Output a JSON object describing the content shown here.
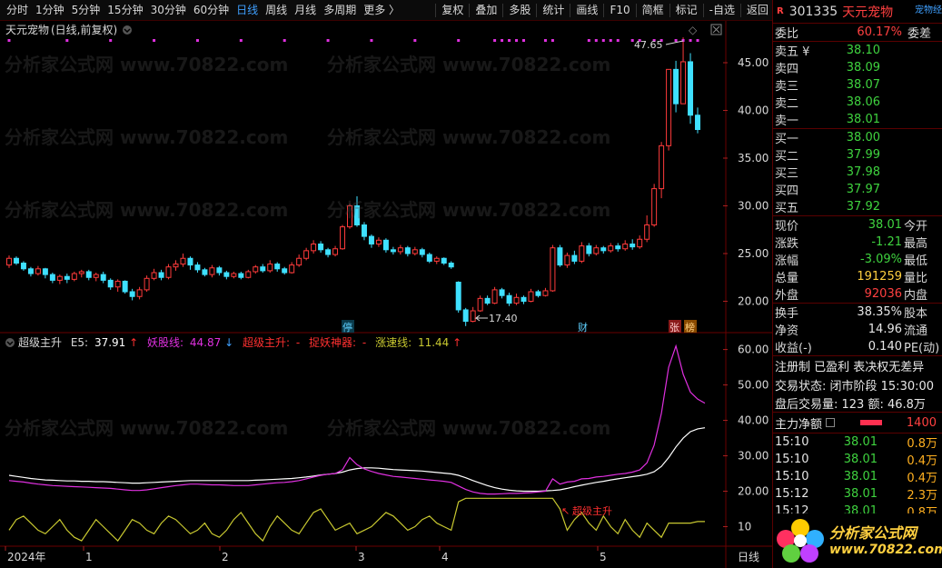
{
  "toolbar": {
    "left": [
      "分时",
      "1分钟",
      "5分钟",
      "15分钟",
      "30分钟",
      "60分钟",
      "日线",
      "周线",
      "月线",
      "多周期",
      "更多 〉"
    ],
    "active": "日线",
    "right": [
      "复权",
      "叠加",
      "多股",
      "统计",
      "画线",
      "F10",
      "简框",
      "标记",
      "-自选",
      "返回"
    ]
  },
  "main_chart": {
    "title": "天元宠物",
    "mode": "(日线,前复权)",
    "high_label": "47.65",
    "low_label": "17.40",
    "markers": [
      "停",
      "财",
      "张",
      "榜"
    ]
  },
  "indicator": {
    "name": "超级主升",
    "e5_label": "E5:",
    "e5_value": "37.91",
    "yao_label": "妖股线:",
    "yao_value": "44.87",
    "zs_label": "超级主升:",
    "zs_value": "-",
    "zy_label": "捉妖神器:",
    "zy_value": "-",
    "zsx_label": "涨速线:",
    "zsx_value": "11.44",
    "signal": "超级主升"
  },
  "x_axis": {
    "labels": [
      "2024年",
      "1",
      "2",
      "3",
      "4",
      "5"
    ],
    "right_label": "日线"
  },
  "chart_data": [
    {
      "type": "candlestick",
      "title": "天元宠物",
      "ylim": [
        17,
        49
      ],
      "yticks": [
        "45.00",
        "40.00",
        "35.00",
        "30.00",
        "25.00",
        "20.00"
      ],
      "candles": [
        [
          23.8,
          24.5,
          24.8,
          23.5
        ],
        [
          24.5,
          24.0,
          24.7,
          23.8
        ],
        [
          24.0,
          23.4,
          24.2,
          23.2
        ],
        [
          23.4,
          22.9,
          23.6,
          22.6
        ],
        [
          22.9,
          23.4,
          23.7,
          22.7
        ],
        [
          23.4,
          22.8,
          23.5,
          22.4
        ],
        [
          22.8,
          22.2,
          23.0,
          21.9
        ],
        [
          22.2,
          22.6,
          22.8,
          21.8
        ],
        [
          22.6,
          22.3,
          22.9,
          21.9
        ],
        [
          22.3,
          22.9,
          23.1,
          22.1
        ],
        [
          22.9,
          23.1,
          23.3,
          22.5
        ],
        [
          23.1,
          22.5,
          23.3,
          22.2
        ],
        [
          22.5,
          22.8,
          23.0,
          22.1
        ],
        [
          22.8,
          22.2,
          23.1,
          21.9
        ],
        [
          22.2,
          21.5,
          22.4,
          21.2
        ],
        [
          21.5,
          22.1,
          22.3,
          21.0
        ],
        [
          22.1,
          21.0,
          22.2,
          20.8
        ],
        [
          21.0,
          20.5,
          21.3,
          20.1
        ],
        [
          20.5,
          21.2,
          21.5,
          20.2
        ],
        [
          21.2,
          22.4,
          22.7,
          21.0
        ],
        [
          22.4,
          23.0,
          23.4,
          22.2
        ],
        [
          23.0,
          22.5,
          23.3,
          22.2
        ],
        [
          22.5,
          23.6,
          23.9,
          22.3
        ],
        [
          23.6,
          23.9,
          24.3,
          23.2
        ],
        [
          23.9,
          24.5,
          25.0,
          23.6
        ],
        [
          24.5,
          23.8,
          24.7,
          23.3
        ],
        [
          23.8,
          23.3,
          24.1,
          23.0
        ],
        [
          23.3,
          22.8,
          23.5,
          22.6
        ],
        [
          22.8,
          23.5,
          23.8,
          22.5
        ],
        [
          23.5,
          23.0,
          23.7,
          22.7
        ],
        [
          23.0,
          22.6,
          23.2,
          22.3
        ],
        [
          22.6,
          22.9,
          23.1,
          22.4
        ],
        [
          22.9,
          22.5,
          23.1,
          22.3
        ],
        [
          22.5,
          23.1,
          23.3,
          22.4
        ],
        [
          23.1,
          23.6,
          23.8,
          22.9
        ],
        [
          23.6,
          23.2,
          23.9,
          23.0
        ],
        [
          23.2,
          23.9,
          24.3,
          23.0
        ],
        [
          23.9,
          23.4,
          24.1,
          23.1
        ],
        [
          23.4,
          23.0,
          23.6,
          22.8
        ],
        [
          23.0,
          23.8,
          24.1,
          22.9
        ],
        [
          23.8,
          24.5,
          24.9,
          23.6
        ],
        [
          24.5,
          25.3,
          25.6,
          24.3
        ],
        [
          25.3,
          26.0,
          26.4,
          25.0
        ],
        [
          26.0,
          25.4,
          26.3,
          25.1
        ],
        [
          25.4,
          24.9,
          25.6,
          24.6
        ],
        [
          24.9,
          25.5,
          25.8,
          24.7
        ],
        [
          25.5,
          27.8,
          28.0,
          25.4
        ],
        [
          27.8,
          30.0,
          30.2,
          27.6
        ],
        [
          30.0,
          28.0,
          31.0,
          27.8
        ],
        [
          28.0,
          26.8,
          28.3,
          26.4
        ],
        [
          26.8,
          26.0,
          27.0,
          25.6
        ],
        [
          26.0,
          26.4,
          26.7,
          25.7
        ],
        [
          26.4,
          25.4,
          26.6,
          25.1
        ],
        [
          25.4,
          25.2,
          25.7,
          24.9
        ],
        [
          25.2,
          25.6,
          25.9,
          24.9
        ],
        [
          25.6,
          25.0,
          25.8,
          24.7
        ],
        [
          25.0,
          25.4,
          25.7,
          24.8
        ],
        [
          25.4,
          24.9,
          25.6,
          24.6
        ],
        [
          24.9,
          24.2,
          25.1,
          24.0
        ],
        [
          24.2,
          24.5,
          24.7,
          23.9
        ],
        [
          24.5,
          24.0,
          24.6,
          23.8
        ],
        [
          24.0,
          23.6,
          24.2,
          23.4
        ],
        [
          22.0,
          19.1,
          22.1,
          18.8
        ],
        [
          19.1,
          17.9,
          19.3,
          17.4
        ],
        [
          17.9,
          19.0,
          19.4,
          17.8
        ],
        [
          19.0,
          20.3,
          20.6,
          18.9
        ],
        [
          20.3,
          19.8,
          20.6,
          19.6
        ],
        [
          19.8,
          21.2,
          21.5,
          19.7
        ],
        [
          21.2,
          20.6,
          21.4,
          20.3
        ],
        [
          20.6,
          19.8,
          20.9,
          19.5
        ],
        [
          19.8,
          20.4,
          20.8,
          19.6
        ],
        [
          20.4,
          20.0,
          20.6,
          19.7
        ],
        [
          20.0,
          21.0,
          21.3,
          19.9
        ],
        [
          21.0,
          20.6,
          21.2,
          20.4
        ],
        [
          20.6,
          21.1,
          21.4,
          20.5
        ],
        [
          21.1,
          25.6,
          25.9,
          21.0
        ],
        [
          25.6,
          23.8,
          25.9,
          23.6
        ],
        [
          23.8,
          24.8,
          25.1,
          23.5
        ],
        [
          24.8,
          24.2,
          25.3,
          23.9
        ],
        [
          24.2,
          25.8,
          26.2,
          24.0
        ],
        [
          25.8,
          25.0,
          26.1,
          24.7
        ],
        [
          25.0,
          25.6,
          25.9,
          24.8
        ],
        [
          25.6,
          25.3,
          25.8,
          25.0
        ],
        [
          25.3,
          25.8,
          26.1,
          25.1
        ],
        [
          25.8,
          25.5,
          26.1,
          25.2
        ],
        [
          25.5,
          26.0,
          26.4,
          25.3
        ],
        [
          26.0,
          25.7,
          26.5,
          25.4
        ],
        [
          25.7,
          26.5,
          26.9,
          25.5
        ],
        [
          26.5,
          28.0,
          29.0,
          26.2
        ],
        [
          28.0,
          31.8,
          32.3,
          27.8
        ],
        [
          31.8,
          36.3,
          36.7,
          30.8
        ],
        [
          36.3,
          44.3,
          44.3,
          35.8
        ],
        [
          44.3,
          40.7,
          45.2,
          39.8
        ],
        [
          40.7,
          45.1,
          47.65,
          41.8
        ],
        [
          45.1,
          39.5,
          46.0,
          38.6
        ],
        [
          39.5,
          38.0,
          40.3,
          37.6
        ]
      ]
    },
    {
      "type": "line",
      "title": "超级主升",
      "ylim": [
        5,
        64
      ],
      "yticks": [
        "60.00",
        "50.00",
        "40.00",
        "30.00",
        "20.00",
        "10"
      ],
      "series": [
        {
          "name": "E5",
          "color": "#ffffff",
          "values": [
            24.5,
            24.2,
            23.9,
            23.6,
            23.4,
            23.2,
            23.1,
            23.0,
            22.9,
            22.9,
            22.8,
            22.8,
            22.7,
            22.7,
            22.6,
            22.5,
            22.4,
            22.3,
            22.3,
            22.4,
            22.5,
            22.6,
            22.7,
            22.8,
            22.9,
            23.0,
            23.0,
            23.0,
            23.0,
            23.0,
            23.0,
            23.0,
            23.0,
            23.0,
            23.1,
            23.2,
            23.3,
            23.4,
            23.5,
            23.6,
            23.8,
            24.0,
            24.3,
            24.6,
            24.8,
            25.0,
            25.4,
            26.0,
            26.4,
            26.6,
            26.6,
            26.5,
            26.3,
            26.1,
            26.0,
            25.9,
            25.8,
            25.7,
            25.5,
            25.3,
            25.1,
            24.9,
            24.5,
            23.8,
            23.0,
            22.3,
            21.6,
            21.0,
            20.6,
            20.3,
            20.1,
            20.0,
            20.0,
            20.0,
            20.1,
            20.2,
            20.4,
            20.8,
            21.3,
            21.7,
            22.1,
            22.5,
            22.8,
            23.2,
            23.5,
            23.8,
            24.1,
            24.4,
            24.8,
            25.5,
            27.0,
            29.5,
            32.5,
            35.0,
            36.8,
            37.6,
            37.91
          ]
        },
        {
          "name": "妖股线",
          "color": "#e030e0",
          "values": [
            23.0,
            22.8,
            22.6,
            22.3,
            22.0,
            21.8,
            21.6,
            21.5,
            21.4,
            21.3,
            21.2,
            21.1,
            21.0,
            20.9,
            20.8,
            20.6,
            20.4,
            20.2,
            20.2,
            20.4,
            20.7,
            21.0,
            21.3,
            21.6,
            21.8,
            22.0,
            22.0,
            21.9,
            21.8,
            21.8,
            21.7,
            21.6,
            21.6,
            21.6,
            21.8,
            22.0,
            22.2,
            22.4,
            22.5,
            22.7,
            23.0,
            23.5,
            24.0,
            24.5,
            24.8,
            25.0,
            26.0,
            29.5,
            27.5,
            26.3,
            25.6,
            25.0,
            24.6,
            24.2,
            24.0,
            23.8,
            23.6,
            23.4,
            23.2,
            23.0,
            22.8,
            22.5,
            21.5,
            20.5,
            19.8,
            19.4,
            19.2,
            19.2,
            19.3,
            19.4,
            19.4,
            19.5,
            19.6,
            19.8,
            20.0,
            23.5,
            22.0,
            22.6,
            22.8,
            23.5,
            23.6,
            24.0,
            24.2,
            24.5,
            24.8,
            25.0,
            25.4,
            26.0,
            28.0,
            33.0,
            42.0,
            55.0,
            61.0,
            53.0,
            48.0,
            46.0,
            44.87
          ]
        },
        {
          "name": "涨速线",
          "color": "#c8c830",
          "values": [
            9,
            12,
            13,
            11,
            9,
            8,
            10,
            12,
            9,
            7,
            6,
            9,
            12,
            10,
            8,
            6,
            9,
            12,
            11,
            9,
            8,
            11,
            13,
            12,
            10,
            8,
            9,
            11,
            8,
            7,
            9,
            12,
            14,
            11,
            8,
            6,
            10,
            13,
            11,
            9,
            8,
            11,
            14,
            15,
            12,
            9,
            10,
            11,
            8,
            9,
            10,
            12,
            14,
            13,
            11,
            9,
            10,
            12,
            13,
            11,
            10,
            9,
            17,
            18,
            18,
            18,
            18,
            18,
            18,
            18,
            18,
            18,
            18,
            18,
            18,
            18,
            15,
            9,
            12,
            14,
            11,
            9,
            13,
            10,
            8,
            12,
            9,
            7,
            11,
            9,
            7,
            11,
            11,
            11,
            11,
            11.44,
            11.44
          ]
        }
      ]
    }
  ],
  "right_panel": {
    "code_badge": "R",
    "code": "301335",
    "name": "天元宠物",
    "tag": "宠物经",
    "weibi_label": "委比",
    "weibi_value": "60.17%",
    "weicha_label": "委差",
    "sell": [
      {
        "label": "卖五 ¥",
        "price": "38.10"
      },
      {
        "label": "卖四",
        "price": "38.09"
      },
      {
        "label": "卖三",
        "price": "38.07"
      },
      {
        "label": "卖二",
        "price": "38.06"
      },
      {
        "label": "卖一",
        "price": "38.01"
      }
    ],
    "buy": [
      {
        "label": "买一",
        "price": "38.00"
      },
      {
        "label": "买二",
        "price": "37.99"
      },
      {
        "label": "买三",
        "price": "37.98"
      },
      {
        "label": "买四",
        "price": "37.97"
      },
      {
        "label": "买五",
        "price": "37.92"
      }
    ],
    "quote": [
      {
        "label": "现价",
        "value": "38.01",
        "extra": "今开",
        "cls": "green"
      },
      {
        "label": "涨跌",
        "value": "-1.21",
        "extra": "最高",
        "cls": "green"
      },
      {
        "label": "涨幅",
        "value": "-3.09%",
        "extra": "最低",
        "cls": "green"
      },
      {
        "label": "总量",
        "value": "191259",
        "extra": "量比",
        "cls": "yellow"
      },
      {
        "label": "外盘",
        "value": "92036",
        "extra": "内盘",
        "cls": "red"
      }
    ],
    "stats": [
      {
        "label": "换手",
        "value": "38.35%",
        "extra": "股本"
      },
      {
        "label": "净资",
        "value": "14.96",
        "extra": "流通"
      },
      {
        "label": "收益(-)",
        "value": "0.140",
        "extra": "PE(动)"
      }
    ],
    "reg_line": "注册制 已盈利 表决权无差异",
    "trade_status": "交易状态: 闭市阶段 15:30:00",
    "after_hours": "盘后交易量: 123  额: 46.8万",
    "main_flow_label": "主力净额",
    "main_flow_value": "1400",
    "ticks": [
      {
        "time": "15:10",
        "price": "38.01",
        "vol": "0.8万"
      },
      {
        "time": "15:10",
        "price": "38.01",
        "vol": "0.4万"
      },
      {
        "time": "15:10",
        "price": "38.01",
        "vol": "0.4万"
      },
      {
        "time": "15:12",
        "price": "38.01",
        "vol": "2.3万"
      },
      {
        "time": "15:12",
        "price": "38.01",
        "vol": "0.8万"
      }
    ],
    "logo_text": "分析家公式网",
    "logo_url": "www.70822.com"
  },
  "watermark": "分析家公式网 www.70822.com"
}
